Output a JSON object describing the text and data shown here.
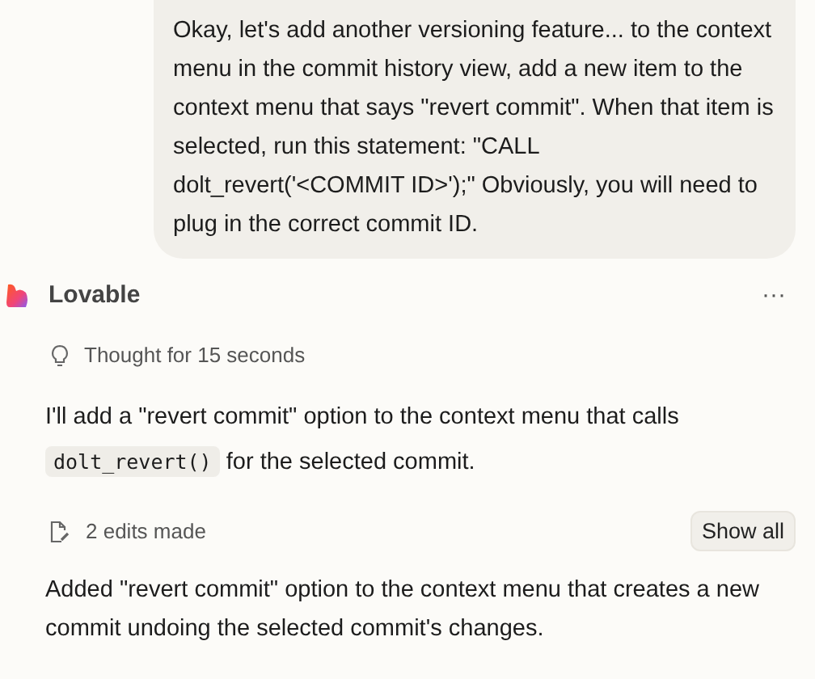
{
  "user_message": "Okay, let's add another versioning feature... to the context menu in the commit history view, add a new item to the context menu that says \"revert commit\". When that item is selected, run this statement: \"CALL dolt_revert('<COMMIT ID>');\" Obviously, you will need to plug in the correct commit ID.",
  "assistant": {
    "name": "Lovable",
    "more": "···"
  },
  "thought": "Thought for 15 seconds",
  "reply": {
    "before": "I'll add a \"revert commit\" option to the context menu that calls",
    "code": "dolt_revert()",
    "after": "for the selected commit."
  },
  "edits": {
    "label": "2 edits made",
    "button": "Show all"
  },
  "summary": "Added \"revert commit\" option to the context menu that creates a new commit undoing the selected commit's changes."
}
